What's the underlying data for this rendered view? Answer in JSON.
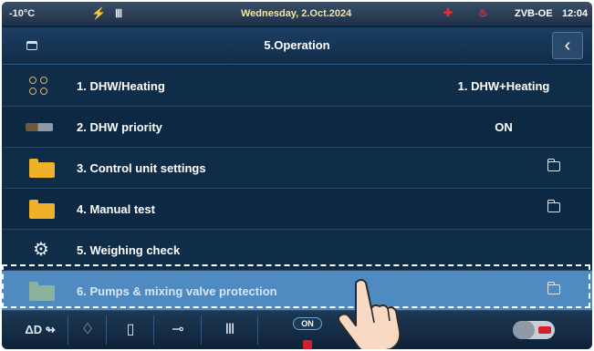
{
  "status": {
    "temperature": "-10°C",
    "date": "Wednesday, 2.Oct.2024",
    "device": "ZVB-OE",
    "time": "12:04"
  },
  "header": {
    "title": "5.Operation"
  },
  "menu": [
    {
      "label": "1.  DHW/Heating",
      "value": "1. DHW+Heating",
      "icon": "dots-icon"
    },
    {
      "label": "2.  DHW priority",
      "value": "ON",
      "icon": "dhw-priority-icon"
    },
    {
      "label": "3.  Control unit settings",
      "icon": "folder-icon"
    },
    {
      "label": "4.  Manual test",
      "icon": "folder-icon"
    },
    {
      "label": "5.  Weighing check",
      "icon": "gear-icon"
    },
    {
      "label": "6.  Pumps & mixing valve protection",
      "icon": "folder-icon"
    }
  ],
  "toolbar": {
    "mode_label": "ΔD",
    "onoff_label": "ON"
  },
  "colors": {
    "background": "#0e2238",
    "selected": "#4f8bc0",
    "folder": "#f0b12a",
    "alert": "#d21f2a"
  }
}
